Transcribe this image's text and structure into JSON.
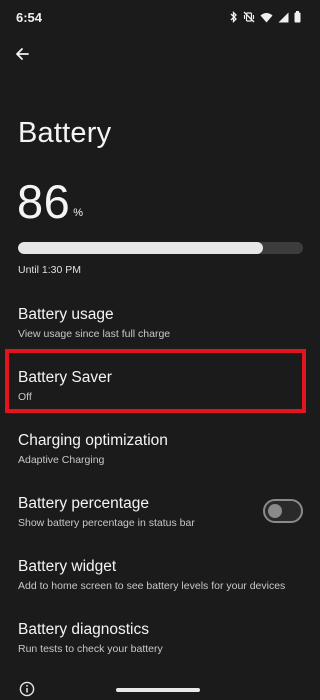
{
  "status_bar": {
    "time": "6:54",
    "icons": [
      "bluetooth-icon",
      "vibrate-off-icon",
      "wifi-icon",
      "signal-icon",
      "battery-icon"
    ]
  },
  "header": {
    "back_icon": "arrow-left-icon",
    "title": "Battery"
  },
  "battery": {
    "level": "86",
    "unit": "%",
    "level_fraction": 0.86,
    "remaining": "Until 1:30 PM"
  },
  "settings": [
    {
      "title": "Battery usage",
      "summary": "View usage since last full charge"
    },
    {
      "title": "Battery Saver",
      "summary": "Off",
      "highlighted": true
    },
    {
      "title": "Charging optimization",
      "summary": "Adaptive Charging"
    },
    {
      "title": "Battery percentage",
      "summary": "Show battery percentage in status bar",
      "toggle": false
    },
    {
      "title": "Battery widget",
      "summary": "Add to home screen to see battery levels for your devices"
    },
    {
      "title": "Battery diagnostics",
      "summary": "Run tests to check your battery"
    }
  ],
  "footer": {
    "icon": "info-icon"
  },
  "colors": {
    "background": "#1b1b1b",
    "highlight": "#e3141d",
    "bar_fill": "#e6e6e6",
    "bar_track": "#3c3c3c"
  }
}
